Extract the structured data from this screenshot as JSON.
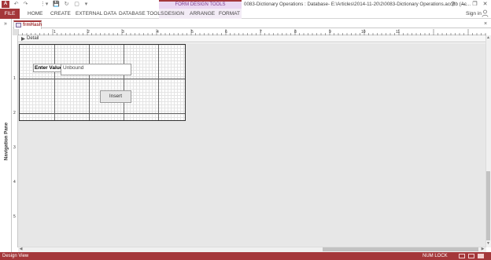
{
  "window": {
    "app_badge": "A",
    "title": "0083-Dictionary Operations : Database- E:\\Articles\\2014-11-20\\2\\0083-Dictionary Operations.accdb (Ac...",
    "context_group": "FORM DESIGN TOOLS",
    "help": "?",
    "minimize": "–",
    "restore": "❐",
    "close": "✕"
  },
  "quick_access": [
    "↶",
    "↷",
    "⋮▾",
    "💾",
    "↻",
    "▢",
    "▾"
  ],
  "ribbon": {
    "file": "FILE",
    "tabs": [
      "HOME",
      "CREATE",
      "EXTERNAL DATA",
      "DATABASE TOOLS",
      "DESIGN",
      "ARRANGE",
      "FORMAT"
    ],
    "sign_in": "Sign in"
  },
  "nav_pane": {
    "toggle": "»",
    "label": "Navigation Pane"
  },
  "document": {
    "tab_label": "frmHash",
    "close": "×",
    "section": "Detail"
  },
  "ruler": {
    "h_numbers": [
      "1",
      "2",
      "3",
      "4",
      "5",
      "6",
      "7",
      "8",
      "9",
      "10",
      "11"
    ],
    "v_numbers": [
      "1",
      "2",
      "3",
      "4",
      "5"
    ]
  },
  "form": {
    "label": "Enter Value",
    "input_value": "Unbound",
    "button": "Insert"
  },
  "status": {
    "view": "Design View",
    "numlock": "NUM LOCK"
  },
  "colors": {
    "accent": "#a4373a",
    "context": "#ead7f2"
  }
}
